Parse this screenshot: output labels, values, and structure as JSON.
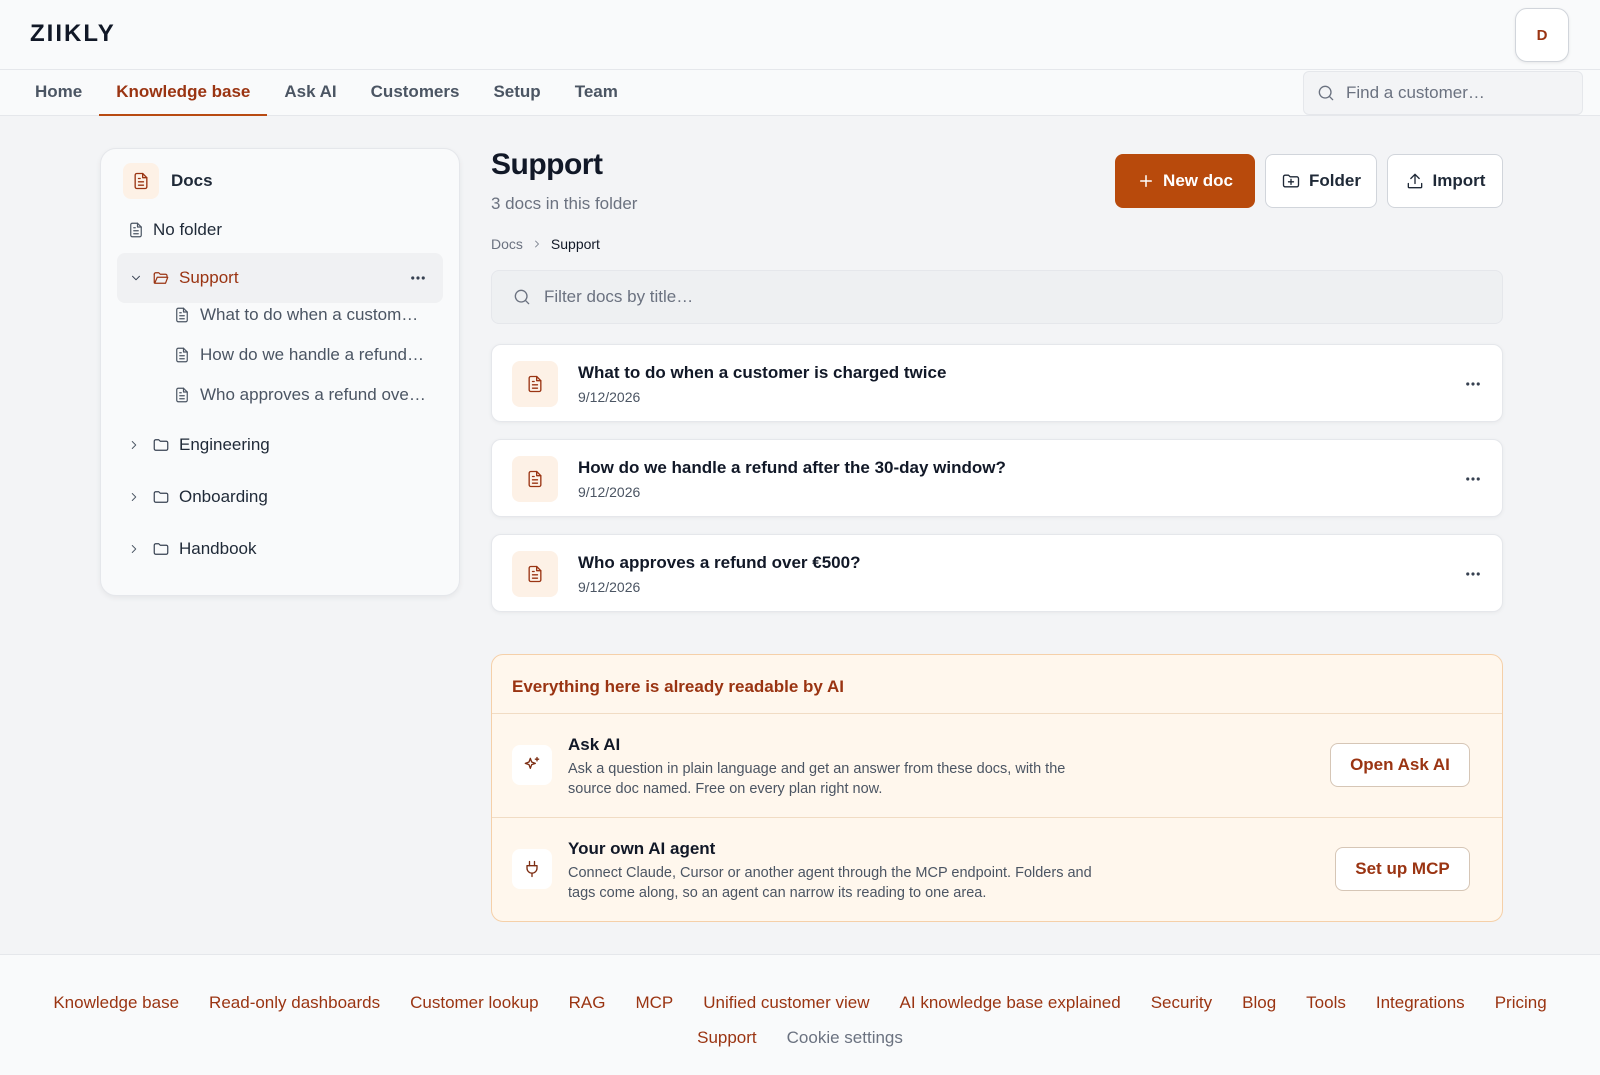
{
  "header": {
    "logo": "ZIIKLY",
    "avatar_initial": "D",
    "search_placeholder": "Find a customer…"
  },
  "nav": {
    "tabs": [
      {
        "label": "Home"
      },
      {
        "label": "Knowledge base",
        "active": true
      },
      {
        "label": "Ask AI"
      },
      {
        "label": "Customers"
      },
      {
        "label": "Setup"
      },
      {
        "label": "Team"
      }
    ]
  },
  "sidebar": {
    "root_label": "Docs",
    "no_folder_label": "No folder",
    "active_folder": {
      "label": "Support",
      "children": [
        "What to do when a custom…",
        "How do we handle a refund…",
        "Who approves a refund ove…"
      ]
    },
    "folders": [
      "Engineering",
      "Onboarding",
      "Handbook"
    ]
  },
  "main": {
    "title": "Support",
    "subtitle": "3 docs in this folder",
    "buttons": {
      "new_doc": "New doc",
      "folder": "Folder",
      "import": "Import"
    },
    "breadcrumb": [
      "Docs",
      "Support"
    ],
    "filter_placeholder": "Filter docs by title…",
    "docs": [
      {
        "title": "What to do when a customer is charged twice",
        "date": "9/12/2026"
      },
      {
        "title": "How do we handle a refund after the 30-day window?",
        "date": "9/12/2026"
      },
      {
        "title": "Who approves a refund over €500?",
        "date": "9/12/2026"
      }
    ]
  },
  "ai_panel": {
    "heading": "Everything here is already readable by AI",
    "rows": [
      {
        "title": "Ask AI",
        "description": "Ask a question in plain language and get an answer from these docs, with the source doc named. Free on every plan right now.",
        "button": "Open Ask AI",
        "icon": "sparkle-icon"
      },
      {
        "title": "Your own AI agent",
        "description": "Connect Claude, Cursor or another agent through the MCP endpoint. Folders and tags come along, so an agent can narrow its reading to one area.",
        "button": "Set up MCP",
        "icon": "plug-icon"
      }
    ]
  },
  "footer": {
    "links": [
      "Knowledge base",
      "Read-only dashboards",
      "Customer lookup",
      "RAG",
      "MCP",
      "Unified customer view",
      "AI knowledge base explained",
      "Security",
      "Blog",
      "Tools",
      "Integrations",
      "Pricing"
    ],
    "links_row2": [
      "Support",
      "Cookie settings"
    ]
  },
  "colors": {
    "accent": "#b84a0c",
    "accent_text": "#9a3412",
    "background": "#f3f4f6"
  }
}
